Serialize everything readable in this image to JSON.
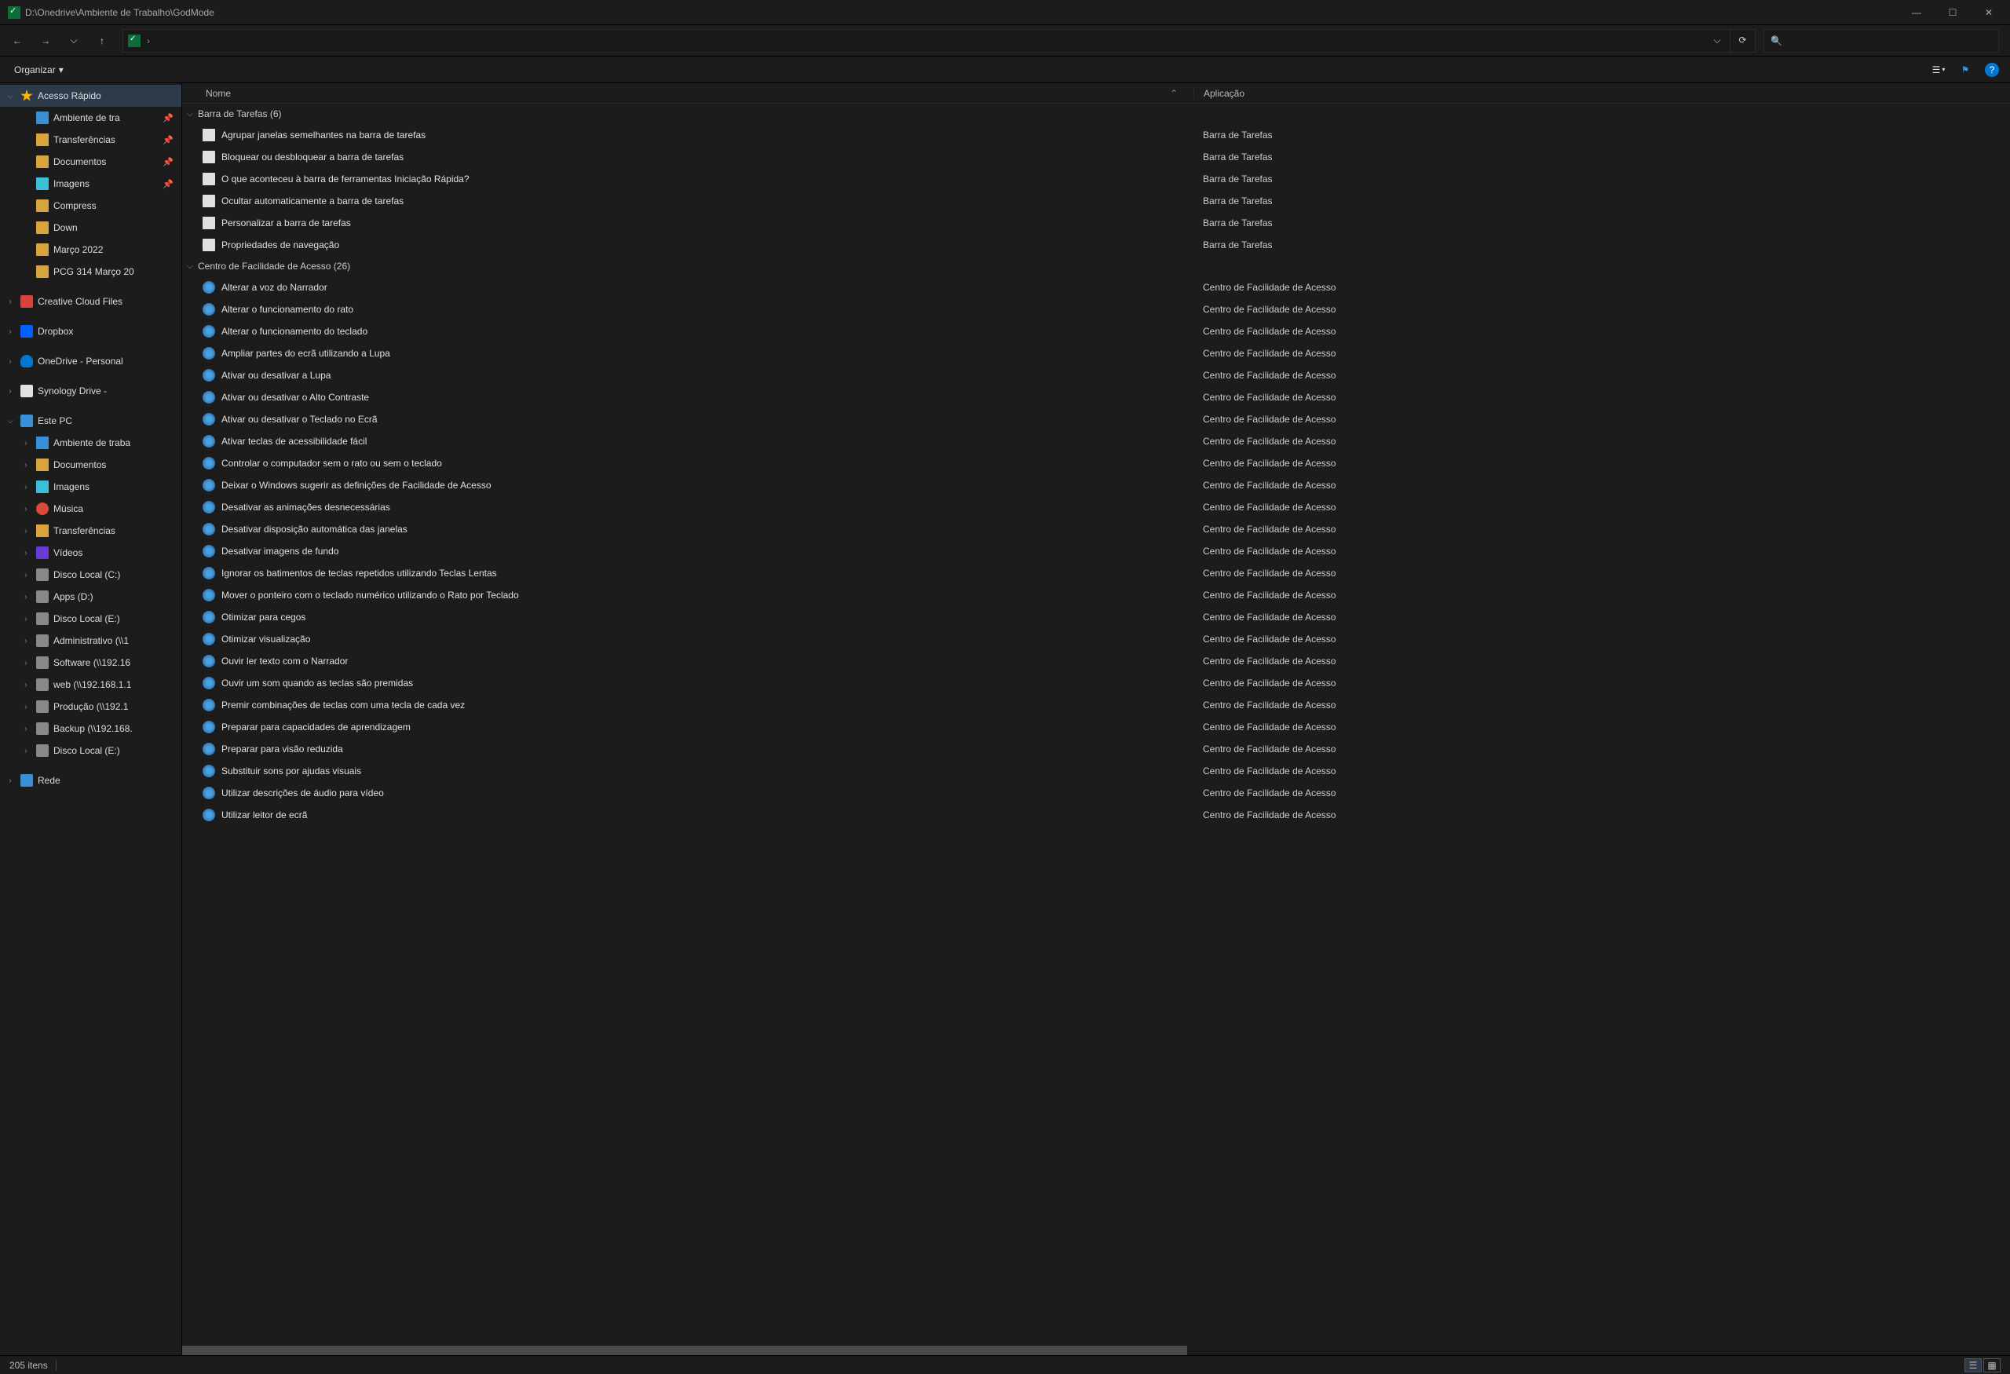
{
  "title_path": "D:\\Onedrive\\Ambiente de Trabalho\\GodMode",
  "win": {
    "min": "—",
    "max": "☐",
    "close": "✕"
  },
  "nav": {
    "back": "←",
    "fwd": "→",
    "down": "⌵",
    "up": "↑",
    "history": "⌵",
    "refresh": "⟳"
  },
  "address_sep": "›",
  "search_placeholder": "",
  "toolbar": {
    "organize": "Organizar",
    "organize_caret": "▾",
    "view_caret": "▾",
    "flag": "⚑"
  },
  "columns": {
    "name": "Nome",
    "app": "Aplicação",
    "sort": "⌃"
  },
  "status": {
    "count": "205 itens"
  },
  "sidebar": [
    {
      "indent": 0,
      "chev": "⌵",
      "icon": "star",
      "label": "Acesso Rápido",
      "selected": true
    },
    {
      "indent": 1,
      "chev": "",
      "icon": "desktop-i",
      "label": "Ambiente de tra",
      "pin": true
    },
    {
      "indent": 1,
      "chev": "",
      "icon": "down-i",
      "label": "Transferências",
      "pin": true
    },
    {
      "indent": 1,
      "chev": "",
      "icon": "folder-y",
      "label": "Documentos",
      "pin": true
    },
    {
      "indent": 1,
      "chev": "",
      "icon": "pic-i",
      "label": "Imagens",
      "pin": true
    },
    {
      "indent": 1,
      "chev": "",
      "icon": "folder-y",
      "label": "Compress"
    },
    {
      "indent": 1,
      "chev": "",
      "icon": "folder-y",
      "label": "Down"
    },
    {
      "indent": 1,
      "chev": "",
      "icon": "folder-y",
      "label": "Março 2022"
    },
    {
      "indent": 1,
      "chev": "",
      "icon": "folder-y",
      "label": "PCG 314 Março 20"
    },
    {
      "indent": 0,
      "chev": "›",
      "icon": "cc-i",
      "label": "Creative Cloud Files"
    },
    {
      "indent": 0,
      "chev": "›",
      "icon": "dropbox-i",
      "label": "Dropbox"
    },
    {
      "indent": 0,
      "chev": "›",
      "icon": "onedrive-i",
      "label": "OneDrive - Personal"
    },
    {
      "indent": 0,
      "chev": "›",
      "icon": "syno-i",
      "label": "Synology Drive -"
    },
    {
      "indent": 0,
      "chev": "⌵",
      "icon": "pc-i",
      "label": "Este PC"
    },
    {
      "indent": 1,
      "chev": "›",
      "icon": "desktop-i",
      "label": "Ambiente de traba"
    },
    {
      "indent": 1,
      "chev": "›",
      "icon": "folder-y",
      "label": "Documentos"
    },
    {
      "indent": 1,
      "chev": "›",
      "icon": "pic-i",
      "label": "Imagens"
    },
    {
      "indent": 1,
      "chev": "›",
      "icon": "music-i",
      "label": "Música"
    },
    {
      "indent": 1,
      "chev": "›",
      "icon": "down-i",
      "label": "Transferências"
    },
    {
      "indent": 1,
      "chev": "›",
      "icon": "video-i",
      "label": "Vídeos"
    },
    {
      "indent": 1,
      "chev": "›",
      "icon": "drive-i",
      "label": "Disco Local (C:)"
    },
    {
      "indent": 1,
      "chev": "›",
      "icon": "drive-i",
      "label": "Apps (D:)"
    },
    {
      "indent": 1,
      "chev": "›",
      "icon": "drive-i",
      "label": "Disco Local (E:)"
    },
    {
      "indent": 1,
      "chev": "›",
      "icon": "drive-i",
      "label": "Administrativo (\\\\1"
    },
    {
      "indent": 1,
      "chev": "›",
      "icon": "drive-i",
      "label": "Software (\\\\192.16"
    },
    {
      "indent": 1,
      "chev": "›",
      "icon": "drive-i",
      "label": "web (\\\\192.168.1.1"
    },
    {
      "indent": 1,
      "chev": "›",
      "icon": "drive-i",
      "label": "Produção (\\\\192.1"
    },
    {
      "indent": 1,
      "chev": "›",
      "icon": "drive-i",
      "label": "Backup (\\\\192.168."
    },
    {
      "indent": 1,
      "chev": "›",
      "icon": "drive-i",
      "label": "Disco Local (E:)"
    },
    {
      "indent": 0,
      "chev": "›",
      "icon": "net-i",
      "label": "Rede"
    }
  ],
  "groups": [
    {
      "label": "Barra de Tarefas (6)",
      "icon": "ico-task",
      "app": "Barra de Tarefas",
      "items": [
        "Agrupar janelas semelhantes na barra de tarefas",
        "Bloquear ou desbloquear a barra de tarefas",
        "O que aconteceu à barra de ferramentas Iniciação Rápida?",
        "Ocultar automaticamente a barra de tarefas",
        "Personalizar a barra de tarefas",
        "Propriedades de navegação"
      ]
    },
    {
      "label": "Centro de Facilidade de Acesso (26)",
      "icon": "ico-ease",
      "app": "Centro de Facilidade de Acesso",
      "items": [
        "Alterar a voz do Narrador",
        "Alterar o funcionamento do rato",
        "Alterar o funcionamento do teclado",
        "Ampliar partes do ecrã utilizando a Lupa",
        "Ativar ou desativar a Lupa",
        "Ativar ou desativar o Alto Contraste",
        "Ativar ou desativar o Teclado no Ecrã",
        "Ativar teclas de acessibilidade fácil",
        "Controlar o computador sem o rato ou sem o teclado",
        "Deixar o Windows sugerir as definições de Facilidade de Acesso",
        "Desativar as animações desnecessárias",
        "Desativar disposição automática das janelas",
        "Desativar imagens de fundo",
        "Ignorar os batimentos de teclas repetidos utilizando Teclas Lentas",
        "Mover o ponteiro com o teclado numérico utilizando o Rato por Teclado",
        "Otimizar para cegos",
        "Otimizar visualização",
        "Ouvir ler texto com o Narrador",
        "Ouvir um som quando as teclas são premidas",
        "Premir combinações de teclas com uma tecla de cada vez",
        "Preparar para capacidades de aprendizagem",
        "Preparar para visão reduzida",
        "Substituir sons por ajudas visuais",
        "Utilizar descrições de áudio para vídeo",
        "Utilizar leitor de ecrã"
      ]
    }
  ]
}
